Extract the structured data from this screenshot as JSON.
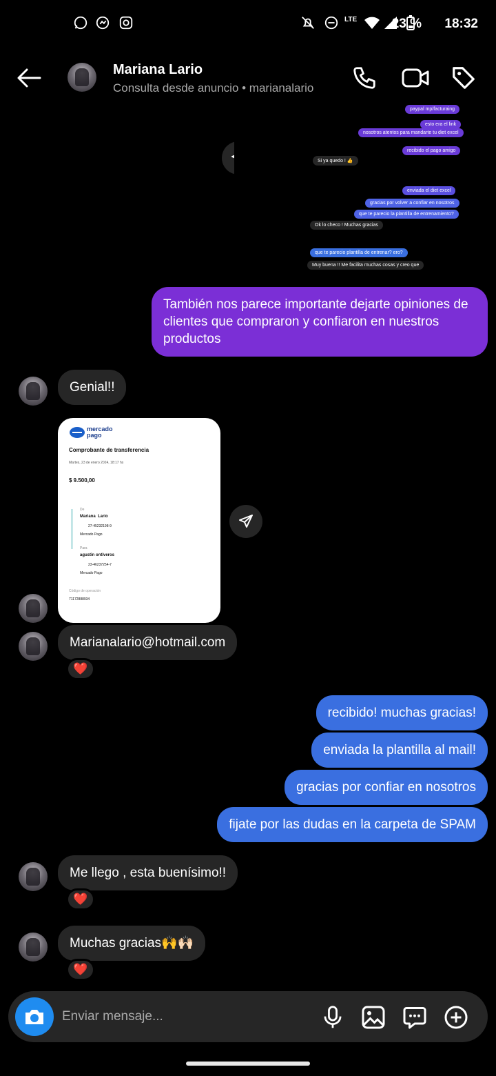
{
  "status_bar": {
    "battery": "23 %",
    "time": "18:32",
    "network": "LTE"
  },
  "header": {
    "contact_name": "Mariana Lario",
    "subtitle": "Consulta desde anuncio • marianalario"
  },
  "thumbnail": {
    "messages": [
      "paypal mp/facturaing",
      "esto era el link",
      "nosotros atentos para mandarte tu diet excel",
      "recibido el pago amigo",
      "Si ya quedo ! 👍",
      "enviada el diet excel",
      "gracias por volver a confiar en nosotros",
      "que te parecio la plantilla de entrenamiento?",
      "Ok lo checo ! Muchas gracias",
      "que te parecio plantilla de entrenar? ero?",
      "Muy buena !! Me facilita muchas cosas y creo que"
    ]
  },
  "messages": {
    "purple_text": "También nos parece importante dejarte opiniones de clientes que compraron y confiaron en nuestros productos",
    "genial": "Genial!!",
    "email": "Marianalario@hotmail.com",
    "out_1": "recibido! muchas gracias!",
    "out_2": "enviada la plantilla al mail!",
    "out_3": "gracias por confiar en nosotros",
    "out_4": "fijate por las dudas en la carpeta de SPAM",
    "llego": "Me llego , esta buenísimo!!",
    "gracias": "Muchas gracias🙌🙌🏻",
    "heart": "❤️"
  },
  "receipt": {
    "brand": "mercado\npago",
    "title": "Comprobante de transferencia",
    "date": "Martes, 23 de enero 2024, 18:17 hs",
    "amount": "$ 9.500,00",
    "from_label": "De",
    "from_name": "Mariana  Lario",
    "from_id": "27-45232198-9",
    "from_bank": "Mercado Pago",
    "to_label": "Para",
    "to_name": "agustin ontiveros",
    "to_id": "23-46237254-7",
    "to_bank": "Mercado Pago",
    "op_label": "Código de operación",
    "op_number": "71172888934"
  },
  "composer": {
    "placeholder": "Enviar mensaje..."
  },
  "colors": {
    "outgoing": "#3a6fe0",
    "purple": "#7b2fd6",
    "incoming": "#262626",
    "camera": "#1f8cf0"
  },
  "icons": [
    "whatsapp-icon",
    "messenger-icon",
    "instagram-icon",
    "mute-icon",
    "dnd-icon",
    "volte-icon",
    "wifi-icon",
    "signal-icon",
    "battery-icon",
    "back-arrow-icon",
    "phone-icon",
    "video-icon",
    "tag-icon",
    "share-icon",
    "heart-icon",
    "camera-icon",
    "microphone-icon",
    "gallery-icon",
    "sticker-icon",
    "add-icon"
  ]
}
